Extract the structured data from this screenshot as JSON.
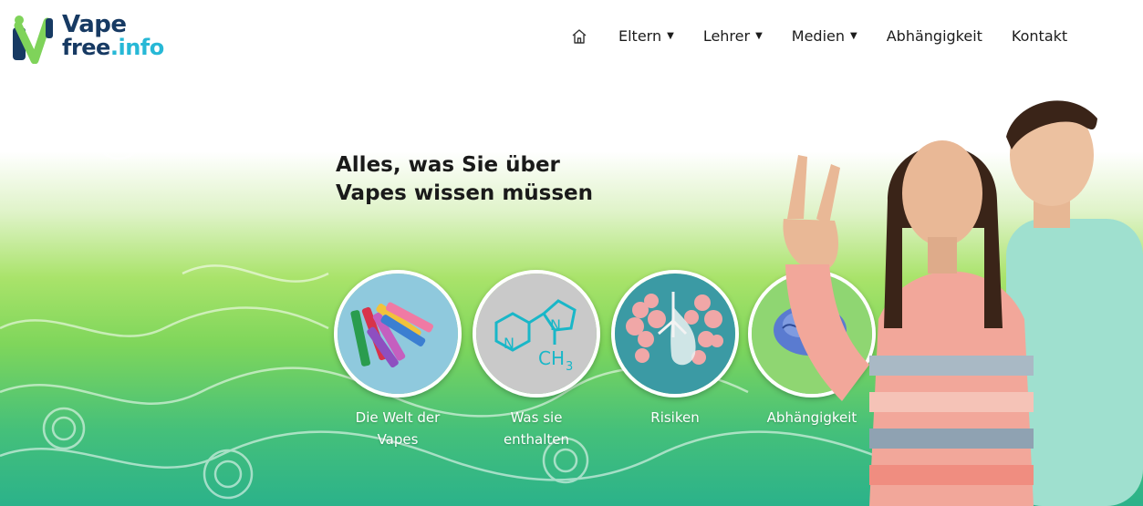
{
  "logo": {
    "line1": "Vape",
    "line2_free": "free",
    "line2_dot": ".",
    "line2_info": "info"
  },
  "nav": {
    "home_icon": "home-icon",
    "items": [
      {
        "label": "Eltern",
        "dropdown": true
      },
      {
        "label": "Lehrer",
        "dropdown": true
      },
      {
        "label": "Medien",
        "dropdown": true
      },
      {
        "label": "Abhängigkeit",
        "dropdown": false
      },
      {
        "label": "Kontakt",
        "dropdown": false
      }
    ]
  },
  "hero": {
    "title_line1": "Alles, was Sie über",
    "title_line2": "Vapes wissen müssen"
  },
  "cards": [
    {
      "label_line1": "Die Welt der",
      "label_line2": "Vapes"
    },
    {
      "label_line1": "Was sie",
      "label_line2": "enthalten",
      "formula_n1": "N",
      "formula_n2": "N",
      "formula_ch": "CH",
      "formula_sub": "3"
    },
    {
      "label_line1": "Risiken",
      "label_line2": ""
    },
    {
      "label_line1": "Abhängigkeit",
      "label_line2": ""
    }
  ],
  "colors": {
    "navy": "#173a63",
    "cyan": "#27b8d6",
    "green": "#7fd65b",
    "text": "#1a1a1a"
  }
}
